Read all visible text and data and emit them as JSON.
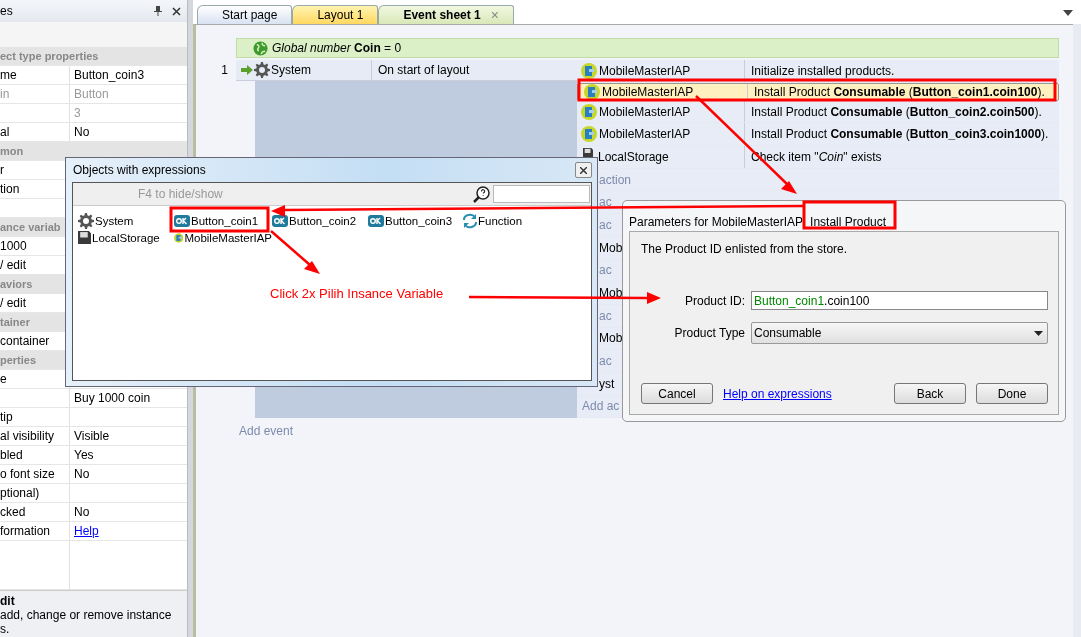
{
  "properties_panel": {
    "title": "es",
    "rows": [
      {
        "kind": "section",
        "name": "ect type properties"
      },
      {
        "kind": "prop",
        "name": "me",
        "value": "Button_coin3",
        "disabled": false
      },
      {
        "kind": "prop",
        "name": "in",
        "value": "Button",
        "disabled": true
      },
      {
        "kind": "prop",
        "value": "3",
        "disabled": true
      },
      {
        "kind": "prop",
        "name": "al",
        "value": "No",
        "disabled": false
      },
      {
        "kind": "section",
        "name": "mon"
      },
      {
        "kind": "prop",
        "name": "r",
        "disabled": false
      },
      {
        "kind": "prop",
        "name": "tion",
        "disabled": false
      },
      {
        "kind": "prop"
      },
      {
        "kind": "section",
        "name": "ance variab"
      },
      {
        "kind": "prop",
        "name": "1000",
        "disabled": false
      },
      {
        "kind": "prop",
        "name": "/ edit",
        "disabled": false
      },
      {
        "kind": "section",
        "name": "aviors"
      },
      {
        "kind": "prop",
        "name": "/ edit",
        "disabled": false
      },
      {
        "kind": "section",
        "name": "tainer"
      },
      {
        "kind": "prop",
        "name": "container",
        "disabled": false
      },
      {
        "kind": "section",
        "name": "perties"
      },
      {
        "kind": "prop",
        "name": "e",
        "disabled": false
      },
      {
        "kind": "prop",
        "value": "Buy 1000 coin",
        "disabled": false
      },
      {
        "kind": "prop",
        "name": "tip",
        "disabled": false
      },
      {
        "kind": "prop",
        "name": "al visibility",
        "value": "Visible",
        "disabled": false
      },
      {
        "kind": "prop",
        "name": "bled",
        "value": "Yes",
        "disabled": false
      },
      {
        "kind": "prop",
        "name": "o font size",
        "value": "No",
        "disabled": false
      },
      {
        "kind": "prop",
        "name": "ptional)",
        "disabled": false
      },
      {
        "kind": "prop",
        "name": "cked",
        "value": "No",
        "disabled": false
      },
      {
        "kind": "link",
        "name": "formation",
        "value": "Help",
        "disabled": false
      }
    ],
    "description": {
      "title": "dit",
      "lines": [
        "add, change or remove instance",
        "s."
      ]
    }
  },
  "tabs": [
    {
      "label": "Start page",
      "kind": "start",
      "selected": false,
      "closable": false
    },
    {
      "label": "Layout 1",
      "kind": "layout",
      "selected": false,
      "closable": false
    },
    {
      "label": "Event sheet 1",
      "kind": "events",
      "selected": true,
      "closable": true
    }
  ],
  "tab_close": "×",
  "event_sheet": {
    "global": "*Global number* **Coin** = 0",
    "event": {
      "number": "1",
      "condition": {
        "object": "System",
        "text": "On start of layout"
      },
      "actions": [
        {
          "kind": "iap",
          "object": "MobileMasterIAP",
          "text": "Initialize installed products.",
          "selected": false
        },
        {
          "kind": "iap",
          "object": "MobileMasterIAP",
          "text": "Install Product **Consumable** (**Button_coin1.coin100**).",
          "selected": true
        },
        {
          "kind": "iap",
          "object": "MobileMasterIAP",
          "text": "Install Product **Consumable** (**Button_coin2.coin500**).",
          "selected": false
        },
        {
          "kind": "iap",
          "object": "MobileMasterIAP",
          "text": "Install Product **Consumable** (**Button_coin3.coin1000**).",
          "selected": false
        },
        {
          "kind": "storage",
          "object": "LocalStorage",
          "text": "Check item \"*Coin*\" exists",
          "selected": false
        },
        {
          "kind": "add",
          "text": "action"
        },
        {
          "kind": "add",
          "text": "ac"
        },
        {
          "kind": "add",
          "text": "ac"
        },
        {
          "kind": "fragment",
          "text": "Mob"
        },
        {
          "kind": "add",
          "text": "ac"
        },
        {
          "kind": "fragment",
          "text": "Mob"
        },
        {
          "kind": "add",
          "text": "ac"
        },
        {
          "kind": "fragment",
          "text": "Mob"
        },
        {
          "kind": "add",
          "text": "ac"
        },
        {
          "kind": "fragment",
          "text": "yst"
        },
        {
          "kind": "add_full",
          "text": "Add ac"
        }
      ]
    },
    "add_event": "Add event"
  },
  "objects_dialog": {
    "title": "Objects with expressions",
    "hint": "F4 to hide/show",
    "objects": [
      {
        "name": "System",
        "kind": "gear"
      },
      {
        "name": "Button_coin1",
        "kind": "button"
      },
      {
        "name": "Button_coin2",
        "kind": "button"
      },
      {
        "name": "Button_coin3",
        "kind": "button"
      },
      {
        "name": "Function",
        "kind": "function"
      },
      {
        "name": "LocalStorage",
        "kind": "storage"
      },
      {
        "name": "MobileMasterIAP",
        "kind": "iap"
      }
    ]
  },
  "params_dialog": {
    "title": "Parameters for MobileMasterIAP",
    "action": "Install Product",
    "description": "The Product ID enlisted from the store.",
    "fields": [
      {
        "kind": "text",
        "label": "Product ID:",
        "value": [
          {
            "text": "Button_coin1",
            "kind": "object"
          },
          {
            "text": ".coin100",
            "kind": "plain"
          }
        ]
      },
      {
        "kind": "select",
        "label": "Product Type",
        "value": [
          {
            "text": "Consumable",
            "kind": "plain"
          }
        ]
      }
    ],
    "buttons": [
      "Cancel",
      "Back",
      "Done"
    ],
    "help_link": "Help on expressions"
  },
  "annotation": {
    "note": "Click 2x Pilih Insance Variable"
  }
}
